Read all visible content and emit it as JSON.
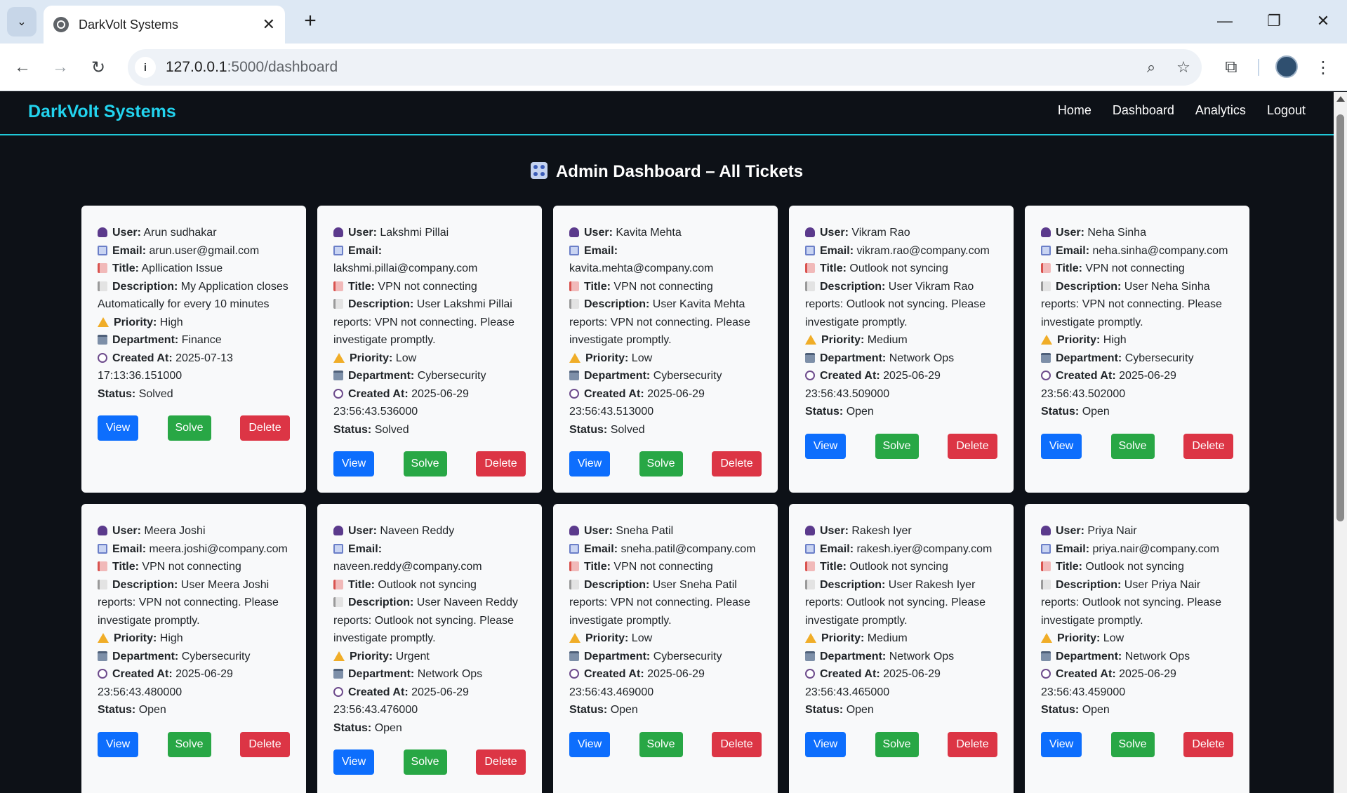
{
  "browser": {
    "tab_title": "DarkVolt Systems",
    "url_host": "127.0.0.1",
    "url_rest": ":5000/dashboard"
  },
  "site": {
    "brand": "DarkVolt Systems",
    "nav": [
      "Home",
      "Dashboard",
      "Analytics",
      "Logout"
    ],
    "heading": "Admin Dashboard – All Tickets"
  },
  "labels": {
    "user": "User:",
    "email": "Email:",
    "title": "Title:",
    "description": "Description:",
    "priority": "Priority:",
    "department": "Department:",
    "created_at": "Created At:",
    "status": "Status:"
  },
  "buttons": {
    "view": "View",
    "solve": "Solve",
    "delete": "Delete"
  },
  "tickets": [
    {
      "user": "Arun sudhakar",
      "email": "arun.user@gmail.com",
      "title": "Apllication Issue",
      "description": "My Application closes Automatically for every 10 minutes",
      "priority": "High",
      "department": "Finance",
      "created_at": "2025-07-13 17:13:36.151000",
      "status": "Solved"
    },
    {
      "user": "Lakshmi Pillai",
      "email": "lakshmi.pillai@company.com",
      "title": "VPN not connecting",
      "description": "User Lakshmi Pillai reports: VPN not connecting. Please investigate promptly.",
      "priority": "Low",
      "department": "Cybersecurity",
      "created_at": "2025-06-29 23:56:43.536000",
      "status": "Solved"
    },
    {
      "user": "Kavita Mehta",
      "email": "kavita.mehta@company.com",
      "title": "VPN not connecting",
      "description": "User Kavita Mehta reports: VPN not connecting. Please investigate promptly.",
      "priority": "Low",
      "department": "Cybersecurity",
      "created_at": "2025-06-29 23:56:43.513000",
      "status": "Solved"
    },
    {
      "user": "Vikram Rao",
      "email": "vikram.rao@company.com",
      "title": "Outlook not syncing",
      "description": "User Vikram Rao reports: Outlook not syncing. Please investigate promptly.",
      "priority": "Medium",
      "department": "Network Ops",
      "created_at": "2025-06-29 23:56:43.509000",
      "status": "Open"
    },
    {
      "user": "Neha Sinha",
      "email": "neha.sinha@company.com",
      "title": "VPN not connecting",
      "description": "User Neha Sinha reports: VPN not connecting. Please investigate promptly.",
      "priority": "High",
      "department": "Cybersecurity",
      "created_at": "2025-06-29 23:56:43.502000",
      "status": "Open"
    },
    {
      "user": "Meera Joshi",
      "email": "meera.joshi@company.com",
      "title": "VPN not connecting",
      "description": "User Meera Joshi reports: VPN not connecting. Please investigate promptly.",
      "priority": "High",
      "department": "Cybersecurity",
      "created_at": "2025-06-29 23:56:43.480000",
      "status": "Open"
    },
    {
      "user": "Naveen Reddy",
      "email": "naveen.reddy@company.com",
      "title": "Outlook not syncing",
      "description": "User Naveen Reddy reports: Outlook not syncing. Please investigate promptly.",
      "priority": "Urgent",
      "department": "Network Ops",
      "created_at": "2025-06-29 23:56:43.476000",
      "status": "Open"
    },
    {
      "user": "Sneha Patil",
      "email": "sneha.patil@company.com",
      "title": "VPN not connecting",
      "description": "User Sneha Patil reports: VPN not connecting. Please investigate promptly.",
      "priority": "Low",
      "department": "Cybersecurity",
      "created_at": "2025-06-29 23:56:43.469000",
      "status": "Open"
    },
    {
      "user": "Rakesh Iyer",
      "email": "rakesh.iyer@company.com",
      "title": "Outlook not syncing",
      "description": "User Rakesh Iyer reports: Outlook not syncing. Please investigate promptly.",
      "priority": "Medium",
      "department": "Network Ops",
      "created_at": "2025-06-29 23:56:43.465000",
      "status": "Open"
    },
    {
      "user": "Priya Nair",
      "email": "priya.nair@company.com",
      "title": "Outlook not syncing",
      "description": "User Priya Nair reports: Outlook not syncing. Please investigate promptly.",
      "priority": "Low",
      "department": "Network Ops",
      "created_at": "2025-06-29 23:56:43.459000",
      "status": "Open"
    }
  ],
  "colors": {
    "accent": "#22d3ee",
    "background": "#0d1117",
    "view": "#0d6efd",
    "solve": "#28a745",
    "delete": "#dc3545"
  }
}
